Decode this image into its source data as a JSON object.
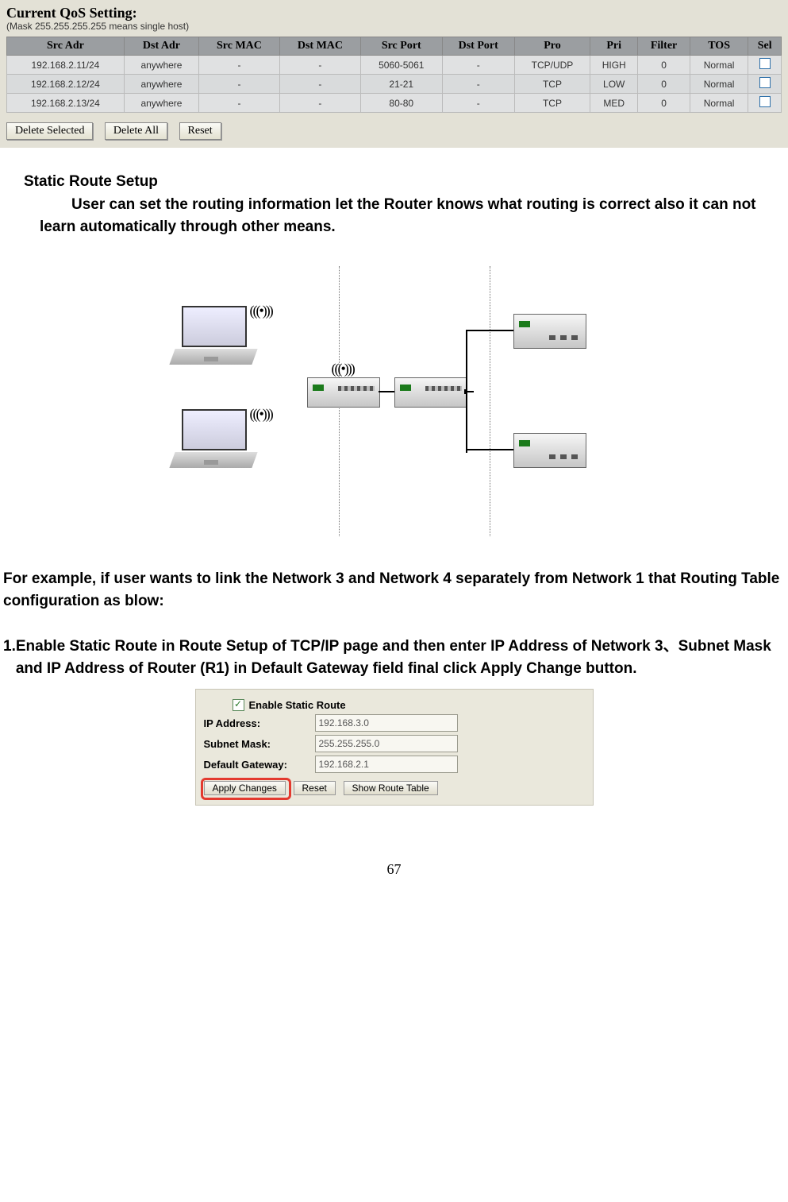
{
  "qos": {
    "title": "Current QoS Setting:",
    "subtitle": "(Mask 255.255.255.255 means single host)",
    "headers": [
      "Src Adr",
      "Dst Adr",
      "Src MAC",
      "Dst MAC",
      "Src Port",
      "Dst Port",
      "Pro",
      "Pri",
      "Filter",
      "TOS",
      "Sel"
    ],
    "rows": [
      {
        "src_adr": "192.168.2.11/24",
        "dst_adr": "anywhere",
        "src_mac": "-",
        "dst_mac": "-",
        "src_port": "5060-5061",
        "dst_port": "-",
        "pro": "TCP/UDP",
        "pri": "HIGH",
        "filter": "0",
        "tos": "Normal"
      },
      {
        "src_adr": "192.168.2.12/24",
        "dst_adr": "anywhere",
        "src_mac": "-",
        "dst_mac": "-",
        "src_port": "21-21",
        "dst_port": "-",
        "pro": "TCP",
        "pri": "LOW",
        "filter": "0",
        "tos": "Normal"
      },
      {
        "src_adr": "192.168.2.13/24",
        "dst_adr": "anywhere",
        "src_mac": "-",
        "dst_mac": "-",
        "src_port": "80-80",
        "dst_port": "-",
        "pro": "TCP",
        "pri": "MED",
        "filter": "0",
        "tos": "Normal"
      }
    ],
    "buttons": {
      "delete_selected": "Delete Selected",
      "delete_all": "Delete All",
      "reset": "Reset"
    }
  },
  "text": {
    "heading": "Static Route Setup",
    "para1": "User can set the routing information let the Router knows what routing is correct also it can not learn automatically through other means.",
    "para2": "For example, if user wants to link the Network 3 and Network 4 separately from Network 1 that Routing Table configuration as blow:",
    "step1_num": "1.",
    "step1": "Enable Static Route in Route Setup of TCP/IP page and then enter IP Address of Network 3、Subnet Mask and IP Address of Router (R1) in Default Gateway field final click Apply Change button."
  },
  "form": {
    "checkbox_checked": "✓",
    "enable_label": "Enable Static Route",
    "ip_label": "IP Address:",
    "ip_value": "192.168.3.0",
    "mask_label": "Subnet Mask:",
    "mask_value": "255.255.255.0",
    "gw_label": "Default Gateway:",
    "gw_value": "192.168.2.1",
    "apply": "Apply Changes",
    "reset": "Reset",
    "show": "Show Route Table"
  },
  "icons": {
    "wifi": "(((•)))"
  },
  "page_number": "67"
}
